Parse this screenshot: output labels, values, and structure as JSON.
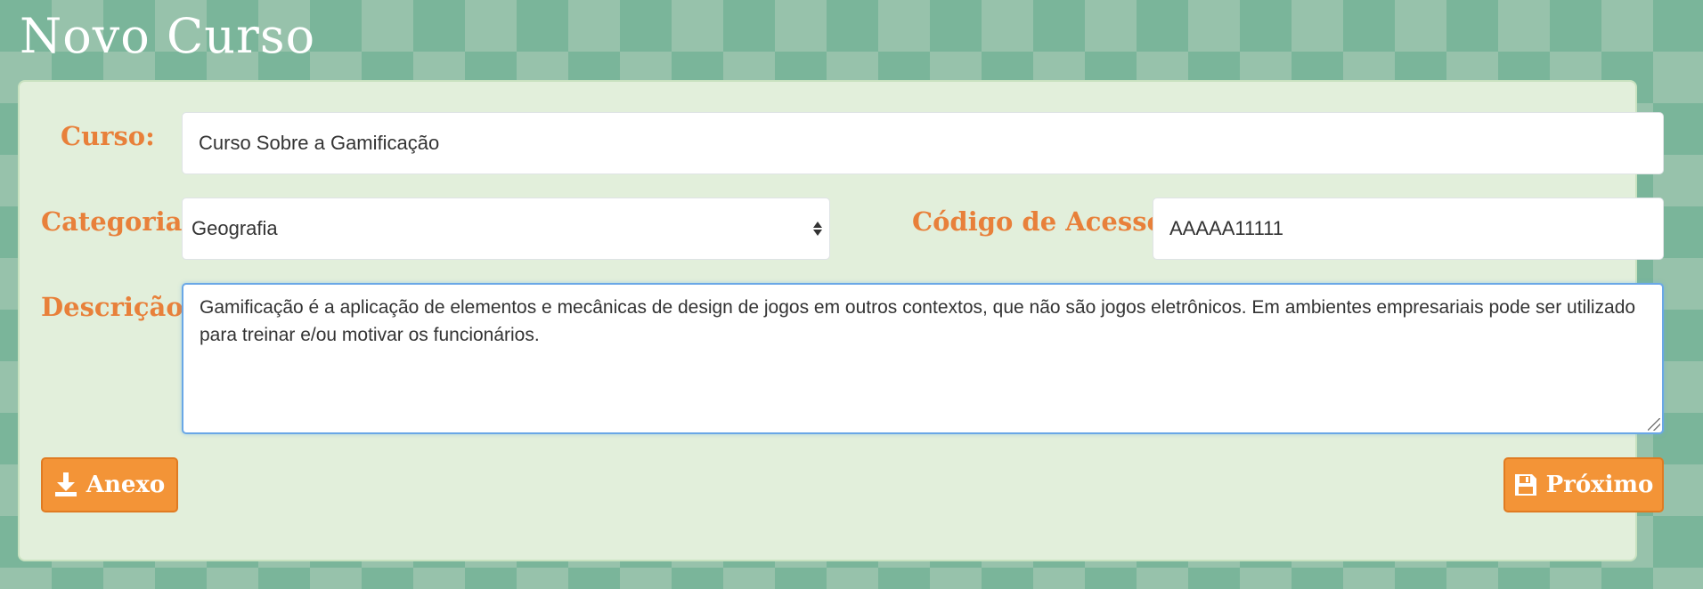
{
  "page": {
    "title": "Novo Curso"
  },
  "form": {
    "curso": {
      "label": "Curso:",
      "value": "Curso Sobre a Gamificação"
    },
    "categoria": {
      "label": "Categoria:",
      "value": "Geografia"
    },
    "codigo": {
      "label": "Código de Acesso:",
      "value": "AAAAA11111"
    },
    "descricao": {
      "label": "Descrição:",
      "value": "Gamificação é a aplicação de elementos e mecânicas de design de jogos em outros contextos, que não são jogos eletrônicos. Em ambientes empresariais pode ser utilizado para treinar e/ou motivar os funcionários."
    }
  },
  "actions": {
    "anexo": {
      "label": "Anexo",
      "icon": "download-icon"
    },
    "proximo": {
      "label": "Próximo",
      "icon": "save-icon"
    }
  },
  "colors": {
    "label": "#e8803a",
    "button": "#f39437",
    "panel": "#e2efdb",
    "focus_border": "#6aa7e6"
  }
}
